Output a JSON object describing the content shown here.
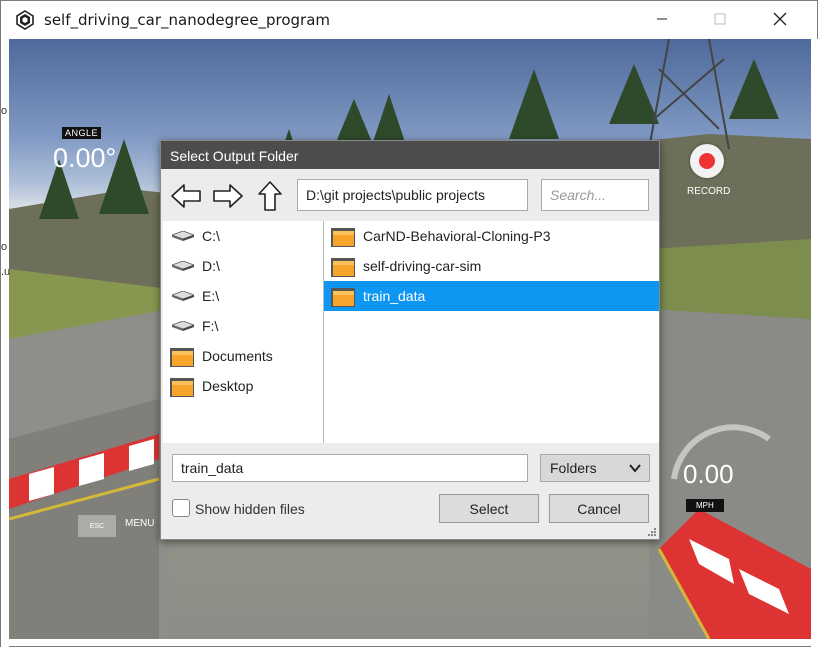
{
  "window": {
    "title": "self_driving_car_nanodegree_program"
  },
  "hud": {
    "angle_label": "ANGLE",
    "angle_value": "0.00°",
    "record_label": "RECORD",
    "speed_value": "0.00",
    "speed_unit": "MPH",
    "esc_label": "ESC",
    "menu_label": "MENU",
    "cut_text_1": "o",
    "cut_text_2": "o",
    "cut_text_3": ".u"
  },
  "dialog": {
    "title": "Select Output Folder",
    "path": "D:\\git projects\\public projects",
    "search_placeholder": "Search...",
    "locations": [
      {
        "label": "C:\\",
        "icon": "drive-icon"
      },
      {
        "label": "D:\\",
        "icon": "drive-icon"
      },
      {
        "label": "E:\\",
        "icon": "drive-icon"
      },
      {
        "label": "F:\\",
        "icon": "drive-icon"
      },
      {
        "label": "Documents",
        "icon": "folder-icon"
      },
      {
        "label": "Desktop",
        "icon": "folder-icon"
      }
    ],
    "folders": [
      {
        "label": "CarND-Behavioral-Cloning-P3",
        "selected": false
      },
      {
        "label": "self-driving-car-sim",
        "selected": false
      },
      {
        "label": "train_data",
        "selected": true
      }
    ],
    "filename": "train_data",
    "filter": "Folders",
    "show_hidden_label": "Show hidden files",
    "select_label": "Select",
    "cancel_label": "Cancel"
  },
  "colors": {
    "selection": "#0d97f2",
    "dialog_title_bg": "#4d4d4d",
    "folder": "#f5a623",
    "record": "#e33333"
  }
}
